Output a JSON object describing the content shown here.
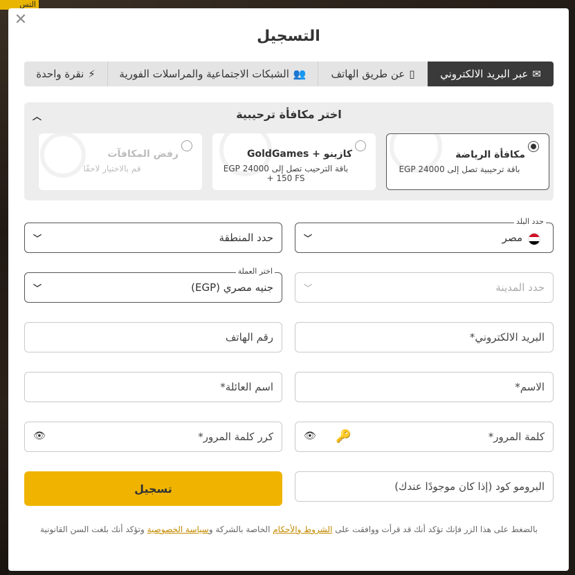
{
  "background": {
    "chip_text": "التس"
  },
  "modal": {
    "close_icon": "close-icon",
    "title": "التسجيل",
    "tabs": [
      {
        "label": "عبر البريد الالكتروني",
        "icon": "envelope-icon",
        "active": true
      },
      {
        "label": "عن طريق الهاتف",
        "icon": "phone-icon",
        "active": false
      },
      {
        "label": "الشبكات الاجتماعية والمراسلات الفورية",
        "icon": "users-icon",
        "active": false
      },
      {
        "label": "نقرة واحدة",
        "icon": "bolt-icon",
        "active": false
      }
    ],
    "bonus": {
      "title": "اختر مكافأة ترحيبية",
      "options": [
        {
          "title": "مكافأة الرياضة",
          "subtitle": "باقة ترحيبية تصل إلى EGP 24000",
          "selected": true
        },
        {
          "title": "كازينو + GoldGames",
          "subtitle": "باقة الترحيب تصل إلى 24000 EGP + 150 FS",
          "selected": false
        },
        {
          "title": "رفض المكافآت",
          "subtitle": "قم بالاختيار لاحقًا",
          "selected": false
        }
      ]
    },
    "form": {
      "country_label": "حدد البلد",
      "country_value": "مصر",
      "region_placeholder": "حدد المنطقة",
      "city_placeholder": "حدد المدينة",
      "currency_label": "اختر العملة",
      "currency_value": "جنيه مصري (EGP)",
      "email_placeholder": "البريد الالكتروني*",
      "phone_placeholder": "رقم الهاتف",
      "first_name_placeholder": "الاسم*",
      "last_name_placeholder": "اسم العائلة*",
      "password_placeholder": "كلمة المرور*",
      "repeat_password_placeholder": "كرر كلمة المرور*",
      "promo_placeholder": "البرومو كود (إذا كان موجودًا عندك)",
      "submit_label": "تسجيل"
    },
    "terms": {
      "prefix": "بالضغط على هذا الزر فإنك تؤكد أنك قد قرأت ووافقت على ",
      "terms_link": "الشروط والأحكام",
      "middle": " الخاصة بالشركة و",
      "privacy_link": "سياسة الخصوصية",
      "suffix": " وتؤكد أنك بلغت السن القانونية"
    },
    "colors": {
      "accent": "#f0b400",
      "active_tab": "#3a3a3a",
      "link": "#c48a00"
    }
  }
}
